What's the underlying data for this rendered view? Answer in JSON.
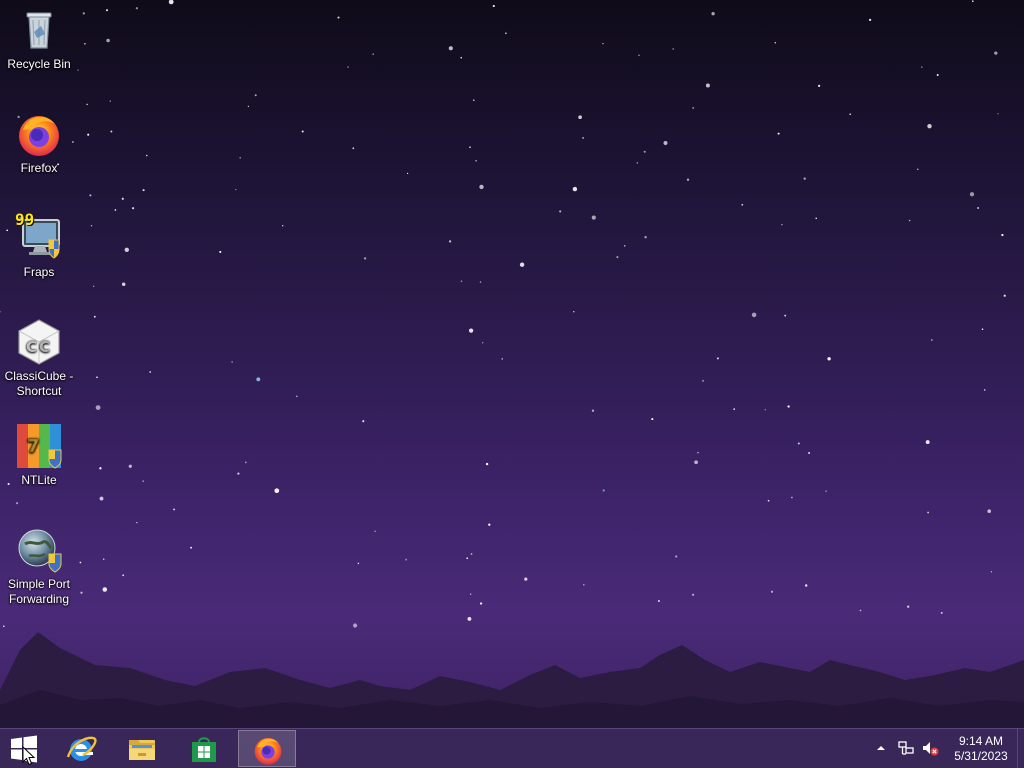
{
  "desktop": {
    "icons": [
      {
        "label": "Recycle Bin",
        "icon": "recycle-bin-icon"
      },
      {
        "label": "Firefox",
        "icon": "firefox-icon"
      },
      {
        "label": "Fraps",
        "icon": "fraps-icon",
        "badge": "99"
      },
      {
        "label": "ClassiCube - Shortcut",
        "icon": "classicube-icon"
      },
      {
        "label": "NTLite",
        "icon": "ntlite-icon"
      },
      {
        "label": "Simple Port Forwarding",
        "icon": "simple-port-forwarding-icon"
      }
    ],
    "wallpaper": "purple-night-sky-mountains"
  },
  "taskbar": {
    "start": {
      "icon": "windows-logo-icon"
    },
    "pinned": [
      {
        "name": "Internet Explorer",
        "icon": "internet-explorer-icon",
        "active": false
      },
      {
        "name": "File Explorer",
        "icon": "file-explorer-icon",
        "active": false
      },
      {
        "name": "Store",
        "icon": "store-icon",
        "active": false
      },
      {
        "name": "Firefox",
        "icon": "firefox-icon",
        "active": true
      }
    ],
    "tray": {
      "icons": [
        "show-hidden-icons-chevron-icon",
        "network-icon",
        "volume-muted-icon"
      ],
      "time": "9:14 AM",
      "date": "5/31/2023"
    }
  },
  "colors": {
    "taskbar": "#3a2858",
    "sky_top": "#0f0b18",
    "sky_bottom": "#4a2a78",
    "mountain": "#2a1a3e"
  }
}
